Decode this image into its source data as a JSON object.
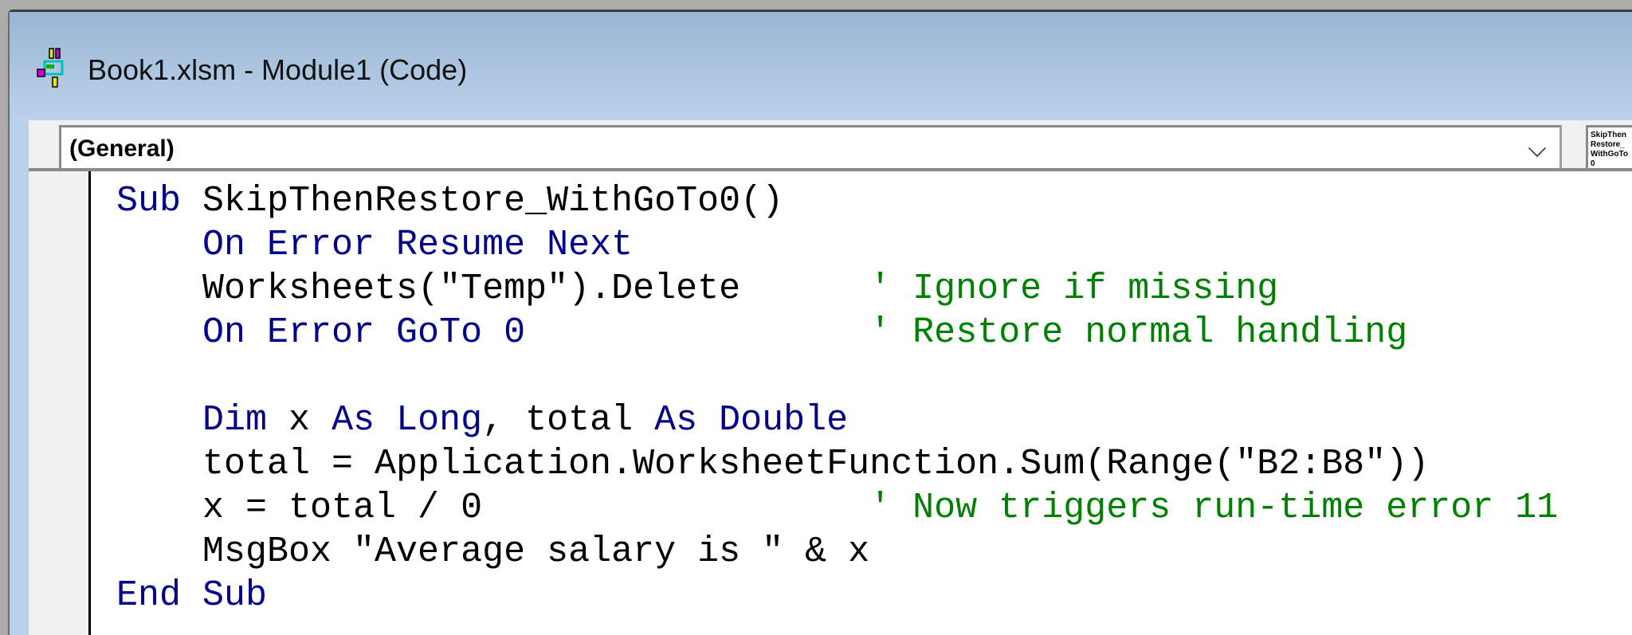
{
  "window": {
    "title": "Book1.xlsm - Module1 (Code)",
    "icon": "vba-module-icon"
  },
  "toolbar": {
    "object_combo": "(General)",
    "procedure_combo": "SkipThenRestore_WithGoTo0"
  },
  "code": {
    "lines": [
      [
        {
          "t": "Sub ",
          "k": "kw"
        },
        {
          "t": "SkipThenRestore_WithGoTo0()",
          "k": ""
        }
      ],
      [
        {
          "t": "    On Error Resume Next",
          "k": "kw"
        }
      ],
      [
        {
          "t": "    Worksheets(\"Temp\").Delete      ",
          "k": ""
        },
        {
          "t": "' Ignore if missing",
          "k": "cm"
        }
      ],
      [
        {
          "t": "    On Error GoTo 0",
          "k": "kw"
        },
        {
          "t": "                ",
          "k": ""
        },
        {
          "t": "' Restore normal handling",
          "k": "cm"
        }
      ],
      [
        {
          "t": "",
          "k": ""
        }
      ],
      [
        {
          "t": "    Dim ",
          "k": "kw"
        },
        {
          "t": "x ",
          "k": ""
        },
        {
          "t": "As Long",
          "k": "kw"
        },
        {
          "t": ", total ",
          "k": ""
        },
        {
          "t": "As Double",
          "k": "kw"
        }
      ],
      [
        {
          "t": "    total = Application.WorksheetFunction.Sum(Range(\"B2:B8\"))",
          "k": ""
        }
      ],
      [
        {
          "t": "    x = total / 0                  ",
          "k": ""
        },
        {
          "t": "' Now triggers run-time error 11",
          "k": "cm"
        }
      ],
      [
        {
          "t": "    MsgBox \"Average salary is \" & x",
          "k": ""
        }
      ],
      [
        {
          "t": "End Sub",
          "k": "kw"
        }
      ]
    ]
  },
  "colors": {
    "keyword": "#00008b",
    "comment": "#008000",
    "text": "#000000"
  }
}
